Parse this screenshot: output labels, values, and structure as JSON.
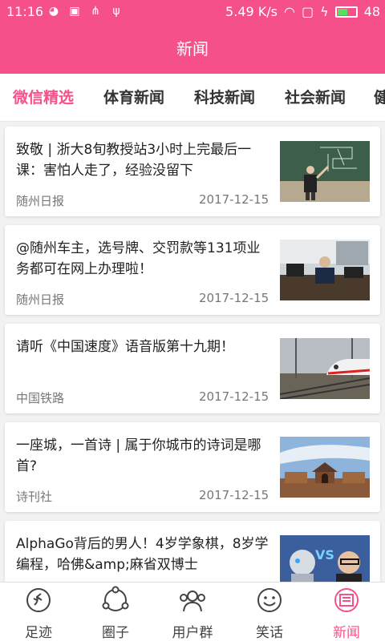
{
  "status_bar": {
    "time": "11:16",
    "speed": "5.49 K/s",
    "battery": "48"
  },
  "header": {
    "title": "新闻"
  },
  "tabs": [
    {
      "label": "微信精选",
      "active": true
    },
    {
      "label": "体育新闻",
      "active": false
    },
    {
      "label": "科技新闻",
      "active": false
    },
    {
      "label": "社会新闻",
      "active": false
    },
    {
      "label": "健",
      "active": false
    }
  ],
  "articles": [
    {
      "title": "致敬 | 浙大8旬教授站3小时上完最后一课：害怕人走了，经验没留下",
      "source": "随州日报",
      "date": "2017-12-15",
      "thumb": "professor-blackboard"
    },
    {
      "title": "@随州车主，选号牌、交罚款等131项业务都可在网上办理啦！",
      "source": "随州日报",
      "date": "2017-12-15",
      "thumb": "police-office"
    },
    {
      "title": "请听《中国速度》语音版第十九期！",
      "source": "中国铁路",
      "date": "2017-12-15",
      "thumb": "high-speed-train"
    },
    {
      "title": "一座城，一首诗 | 属于你城市的诗词是哪首?",
      "source": "诗刊社",
      "date": "2017-12-15",
      "thumb": "city-gate"
    },
    {
      "title": "AlphaGo背后的男人！4岁学象棋，8岁学编程，哈佛&amp;麻省双博士",
      "source": "",
      "date": "",
      "thumb": "robot-vs-man"
    }
  ],
  "bottom_nav": [
    {
      "label": "足迹",
      "icon": "footprint-icon",
      "active": false
    },
    {
      "label": "圈子",
      "icon": "circle-group-icon",
      "active": false
    },
    {
      "label": "用户群",
      "icon": "user-group-icon",
      "active": false
    },
    {
      "label": "笑话",
      "icon": "smiley-icon",
      "active": false
    },
    {
      "label": "新闻",
      "icon": "news-icon",
      "active": true
    }
  ],
  "colors": {
    "accent": "#f5508a"
  }
}
